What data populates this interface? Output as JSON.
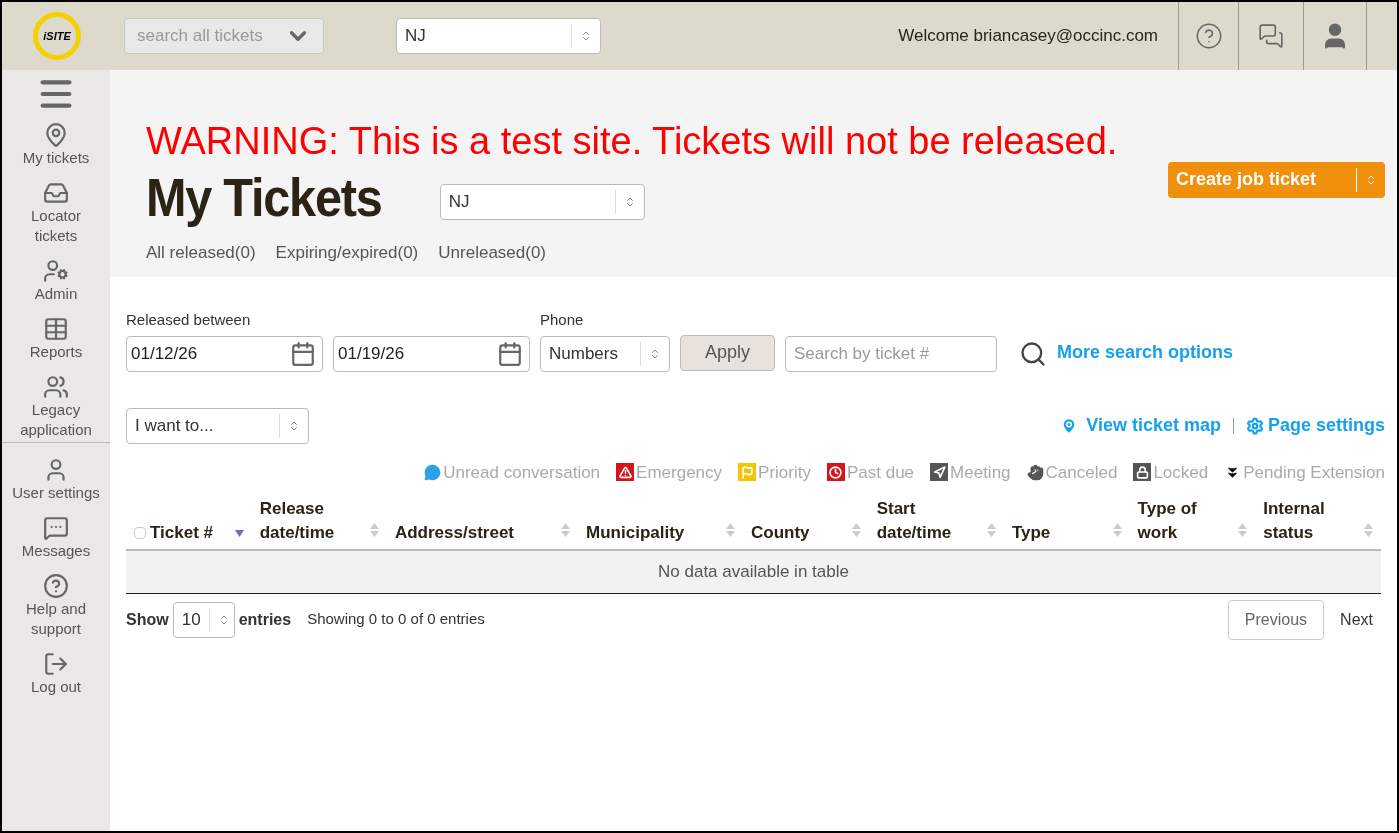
{
  "header": {
    "logo_text": "iSITE",
    "search_placeholder": "search all tickets",
    "state_select": "NJ",
    "welcome": "Welcome briancasey@occinc.com"
  },
  "sidebar": {
    "items": [
      {
        "kind": "pin",
        "label": "My tickets"
      },
      {
        "kind": "inbox",
        "label": "Locator tickets"
      },
      {
        "kind": "admin",
        "label": "Admin"
      },
      {
        "kind": "grid",
        "label": "Reports"
      },
      {
        "kind": "people",
        "label": "Legacy application"
      },
      {
        "kind": "user",
        "label": "User settings"
      },
      {
        "kind": "chat",
        "label": "Messages"
      },
      {
        "kind": "help",
        "label": "Help and support"
      },
      {
        "kind": "logout",
        "label": "Log out"
      }
    ]
  },
  "warning": "WARNING: This is a test site. Tickets will not be released.",
  "page_title": "My Tickets",
  "title_state_select": "NJ",
  "create_button": "Create job ticket",
  "filter_tabs": [
    "All released(0)",
    "Expiring/expired(0)",
    "Unreleased(0)"
  ],
  "filters": {
    "released_label": "Released between",
    "date_from": "01/12/26",
    "date_to": "01/19/26",
    "phone_label": "Phone",
    "phone_select": "Numbers",
    "apply": "Apply",
    "ticket_search_placeholder": "Search by ticket #",
    "more_options": "More search options"
  },
  "actions_select": "I want to...",
  "view_map": "View ticket map",
  "page_settings": "Page settings",
  "legend": [
    {
      "kind": "chat",
      "label": "Unread conversation",
      "color": "#2aa3e8"
    },
    {
      "kind": "warning",
      "label": "Emergency",
      "color": "#d7141b"
    },
    {
      "kind": "flag",
      "label": "Priority",
      "color": "#f5c400"
    },
    {
      "kind": "clock",
      "label": "Past due",
      "color": "#d7141b"
    },
    {
      "kind": "arrow",
      "label": "Meeting",
      "color": "#555555"
    },
    {
      "kind": "hand",
      "label": "Canceled",
      "color": "#555555"
    },
    {
      "kind": "lock",
      "label": "Locked",
      "color": "#555555"
    },
    {
      "kind": "chevrons",
      "label": "Pending Extension",
      "color": "#111111"
    }
  ],
  "table": {
    "columns": [
      {
        "label": "Ticket #",
        "sorted": true
      },
      {
        "label": "Release date/time",
        "sorted": false
      },
      {
        "label": "Address/street",
        "sorted": false
      },
      {
        "label": "Municipality",
        "sorted": false
      },
      {
        "label": "County",
        "sorted": false
      },
      {
        "label": "Start date/time",
        "sorted": false
      },
      {
        "label": "Type",
        "sorted": false
      },
      {
        "label": "Type of work",
        "sorted": false
      },
      {
        "label": "Internal status",
        "sorted": false
      }
    ],
    "empty": "No data available in table"
  },
  "footer": {
    "show": "Show",
    "page_size": "10",
    "entries": "entries",
    "info": "Showing 0 to 0 of 0 entries",
    "previous": "Previous",
    "next": "Next"
  }
}
